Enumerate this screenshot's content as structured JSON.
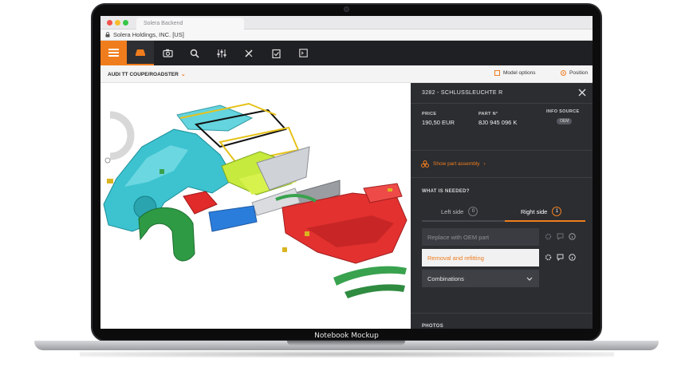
{
  "mockup_label": "Notebook Mockup",
  "browser": {
    "tab_title": "Solera Backend",
    "address": "Solera Holdings, INC. [US]",
    "dot_colors": [
      "#f2544c",
      "#f7bd2e",
      "#37c748"
    ]
  },
  "toolbar": {
    "accent_color": "#f07d1d",
    "tools": [
      {
        "icon": "car-icon",
        "active": true
      },
      {
        "icon": "camera-icon",
        "active": false
      },
      {
        "icon": "search-icon",
        "active": false
      },
      {
        "icon": "sliders-icon",
        "active": false
      },
      {
        "icon": "tools-icon",
        "active": false
      },
      {
        "icon": "checklist-icon",
        "active": false
      },
      {
        "icon": "code-icon",
        "active": false
      }
    ]
  },
  "subheader": {
    "vehicle": "AUDI TT COUPE/ROADSTER",
    "model_options": "Model options",
    "position": "Position"
  },
  "panel": {
    "part_title": "3282 - SCHLUSSLEUCHTE R",
    "price_label": "PRICE",
    "price_value": "190,50 EUR",
    "part_no_label": "PART N°",
    "part_no_value": "8J0 945 096 K",
    "info_source_label": "INFO SOURCE",
    "info_source_value": "OEM",
    "assembly_link": "Show part assembly",
    "needed_title": "WHAT IS NEEDED?",
    "left_side": {
      "label": "Left side",
      "count": "0"
    },
    "right_side": {
      "label": "Right side",
      "count": "1"
    },
    "options": [
      {
        "label": "Replace with OEM part",
        "state": "disabled"
      },
      {
        "label": "Removal and refitting",
        "state": "selected"
      },
      {
        "label": "Combinations",
        "state": "dropdown"
      }
    ],
    "photos_title": "PHOTOS"
  }
}
